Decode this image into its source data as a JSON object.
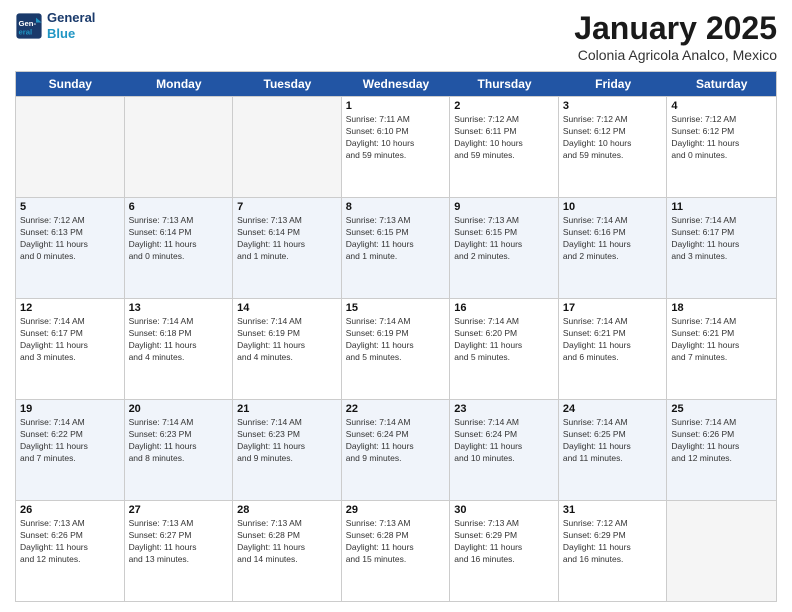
{
  "header": {
    "logo_line1": "General",
    "logo_line2": "Blue",
    "month_title": "January 2025",
    "subtitle": "Colonia Agricola Analco, Mexico"
  },
  "weekdays": [
    "Sunday",
    "Monday",
    "Tuesday",
    "Wednesday",
    "Thursday",
    "Friday",
    "Saturday"
  ],
  "weeks": [
    [
      {
        "day": "",
        "info": "",
        "empty": true
      },
      {
        "day": "",
        "info": "",
        "empty": true
      },
      {
        "day": "",
        "info": "",
        "empty": true
      },
      {
        "day": "1",
        "info": "Sunrise: 7:11 AM\nSunset: 6:10 PM\nDaylight: 10 hours\nand 59 minutes."
      },
      {
        "day": "2",
        "info": "Sunrise: 7:12 AM\nSunset: 6:11 PM\nDaylight: 10 hours\nand 59 minutes."
      },
      {
        "day": "3",
        "info": "Sunrise: 7:12 AM\nSunset: 6:12 PM\nDaylight: 10 hours\nand 59 minutes."
      },
      {
        "day": "4",
        "info": "Sunrise: 7:12 AM\nSunset: 6:12 PM\nDaylight: 11 hours\nand 0 minutes."
      }
    ],
    [
      {
        "day": "5",
        "info": "Sunrise: 7:12 AM\nSunset: 6:13 PM\nDaylight: 11 hours\nand 0 minutes."
      },
      {
        "day": "6",
        "info": "Sunrise: 7:13 AM\nSunset: 6:14 PM\nDaylight: 11 hours\nand 0 minutes."
      },
      {
        "day": "7",
        "info": "Sunrise: 7:13 AM\nSunset: 6:14 PM\nDaylight: 11 hours\nand 1 minute."
      },
      {
        "day": "8",
        "info": "Sunrise: 7:13 AM\nSunset: 6:15 PM\nDaylight: 11 hours\nand 1 minute."
      },
      {
        "day": "9",
        "info": "Sunrise: 7:13 AM\nSunset: 6:15 PM\nDaylight: 11 hours\nand 2 minutes."
      },
      {
        "day": "10",
        "info": "Sunrise: 7:14 AM\nSunset: 6:16 PM\nDaylight: 11 hours\nand 2 minutes."
      },
      {
        "day": "11",
        "info": "Sunrise: 7:14 AM\nSunset: 6:17 PM\nDaylight: 11 hours\nand 3 minutes."
      }
    ],
    [
      {
        "day": "12",
        "info": "Sunrise: 7:14 AM\nSunset: 6:17 PM\nDaylight: 11 hours\nand 3 minutes."
      },
      {
        "day": "13",
        "info": "Sunrise: 7:14 AM\nSunset: 6:18 PM\nDaylight: 11 hours\nand 4 minutes."
      },
      {
        "day": "14",
        "info": "Sunrise: 7:14 AM\nSunset: 6:19 PM\nDaylight: 11 hours\nand 4 minutes."
      },
      {
        "day": "15",
        "info": "Sunrise: 7:14 AM\nSunset: 6:19 PM\nDaylight: 11 hours\nand 5 minutes."
      },
      {
        "day": "16",
        "info": "Sunrise: 7:14 AM\nSunset: 6:20 PM\nDaylight: 11 hours\nand 5 minutes."
      },
      {
        "day": "17",
        "info": "Sunrise: 7:14 AM\nSunset: 6:21 PM\nDaylight: 11 hours\nand 6 minutes."
      },
      {
        "day": "18",
        "info": "Sunrise: 7:14 AM\nSunset: 6:21 PM\nDaylight: 11 hours\nand 7 minutes."
      }
    ],
    [
      {
        "day": "19",
        "info": "Sunrise: 7:14 AM\nSunset: 6:22 PM\nDaylight: 11 hours\nand 7 minutes."
      },
      {
        "day": "20",
        "info": "Sunrise: 7:14 AM\nSunset: 6:23 PM\nDaylight: 11 hours\nand 8 minutes."
      },
      {
        "day": "21",
        "info": "Sunrise: 7:14 AM\nSunset: 6:23 PM\nDaylight: 11 hours\nand 9 minutes."
      },
      {
        "day": "22",
        "info": "Sunrise: 7:14 AM\nSunset: 6:24 PM\nDaylight: 11 hours\nand 9 minutes."
      },
      {
        "day": "23",
        "info": "Sunrise: 7:14 AM\nSunset: 6:24 PM\nDaylight: 11 hours\nand 10 minutes."
      },
      {
        "day": "24",
        "info": "Sunrise: 7:14 AM\nSunset: 6:25 PM\nDaylight: 11 hours\nand 11 minutes."
      },
      {
        "day": "25",
        "info": "Sunrise: 7:14 AM\nSunset: 6:26 PM\nDaylight: 11 hours\nand 12 minutes."
      }
    ],
    [
      {
        "day": "26",
        "info": "Sunrise: 7:13 AM\nSunset: 6:26 PM\nDaylight: 11 hours\nand 12 minutes."
      },
      {
        "day": "27",
        "info": "Sunrise: 7:13 AM\nSunset: 6:27 PM\nDaylight: 11 hours\nand 13 minutes."
      },
      {
        "day": "28",
        "info": "Sunrise: 7:13 AM\nSunset: 6:28 PM\nDaylight: 11 hours\nand 14 minutes."
      },
      {
        "day": "29",
        "info": "Sunrise: 7:13 AM\nSunset: 6:28 PM\nDaylight: 11 hours\nand 15 minutes."
      },
      {
        "day": "30",
        "info": "Sunrise: 7:13 AM\nSunset: 6:29 PM\nDaylight: 11 hours\nand 16 minutes."
      },
      {
        "day": "31",
        "info": "Sunrise: 7:12 AM\nSunset: 6:29 PM\nDaylight: 11 hours\nand 16 minutes."
      },
      {
        "day": "",
        "info": "",
        "empty": true
      }
    ]
  ]
}
